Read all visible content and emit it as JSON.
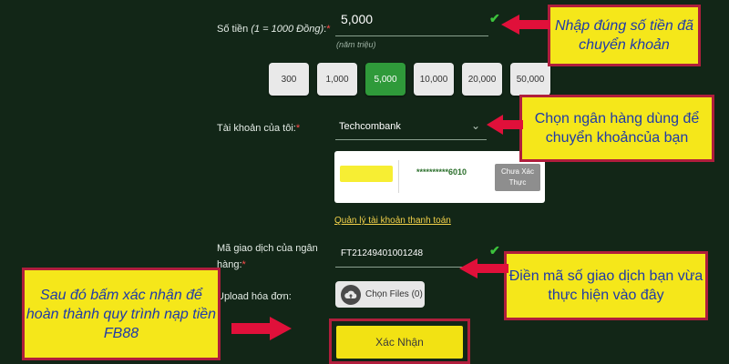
{
  "form": {
    "amount": {
      "label_prefix": "Số tiền ",
      "label_em": "(1 = 1000 Đồng)",
      "label_suffix": ":",
      "required_mark": "*",
      "value": "5,000",
      "hint": "(năm triệu)"
    },
    "quick_amounts": [
      {
        "label": "300",
        "active": false
      },
      {
        "label": "1,000",
        "active": false
      },
      {
        "label": "5,000",
        "active": true
      },
      {
        "label": "10,000",
        "active": false
      },
      {
        "label": "20,000",
        "active": false
      },
      {
        "label": "50,000",
        "active": false
      }
    ],
    "bank": {
      "label": "Tài khoản của tôi:",
      "required_mark": "*",
      "value": "Techcombank"
    },
    "account_card": {
      "account_number": "**********6010",
      "verify_label": "Chưa Xác Thực"
    },
    "manage_link": "Quản lý tài khoản thanh toán",
    "transaction": {
      "label": "Mã giao dịch của ngân hàng:",
      "required_mark": "*",
      "value": "FT21249401001248"
    },
    "upload": {
      "label": "Upload hóa đơn:",
      "button_label": "Chọn Files (0)"
    },
    "submit_label": "Xác Nhận"
  },
  "callouts": {
    "amount": "Nhập đúng số tiền đã chuyển khoản",
    "bank": "Chọn ngân hàng dùng để chuyển khoảncủa bạn",
    "transaction": "Điền mã số giao dịch bạn vừa thực hiện vào đây",
    "submit": "Sau đó bấm xác nhận để hoàn thành quy trình nạp tiền FB88"
  },
  "colors": {
    "background": "#122617",
    "callout_fill": "#f5e71a",
    "callout_border": "#b01e3c",
    "callout_text": "#1f3aa8",
    "arrow": "#e0103a",
    "active_button": "#2f9a3a",
    "submit_button": "#f2e213"
  },
  "icons": [
    "check-icon",
    "chevron-down-icon",
    "upload-cloud-icon",
    "arrow-left-icon",
    "arrow-right-icon"
  ]
}
